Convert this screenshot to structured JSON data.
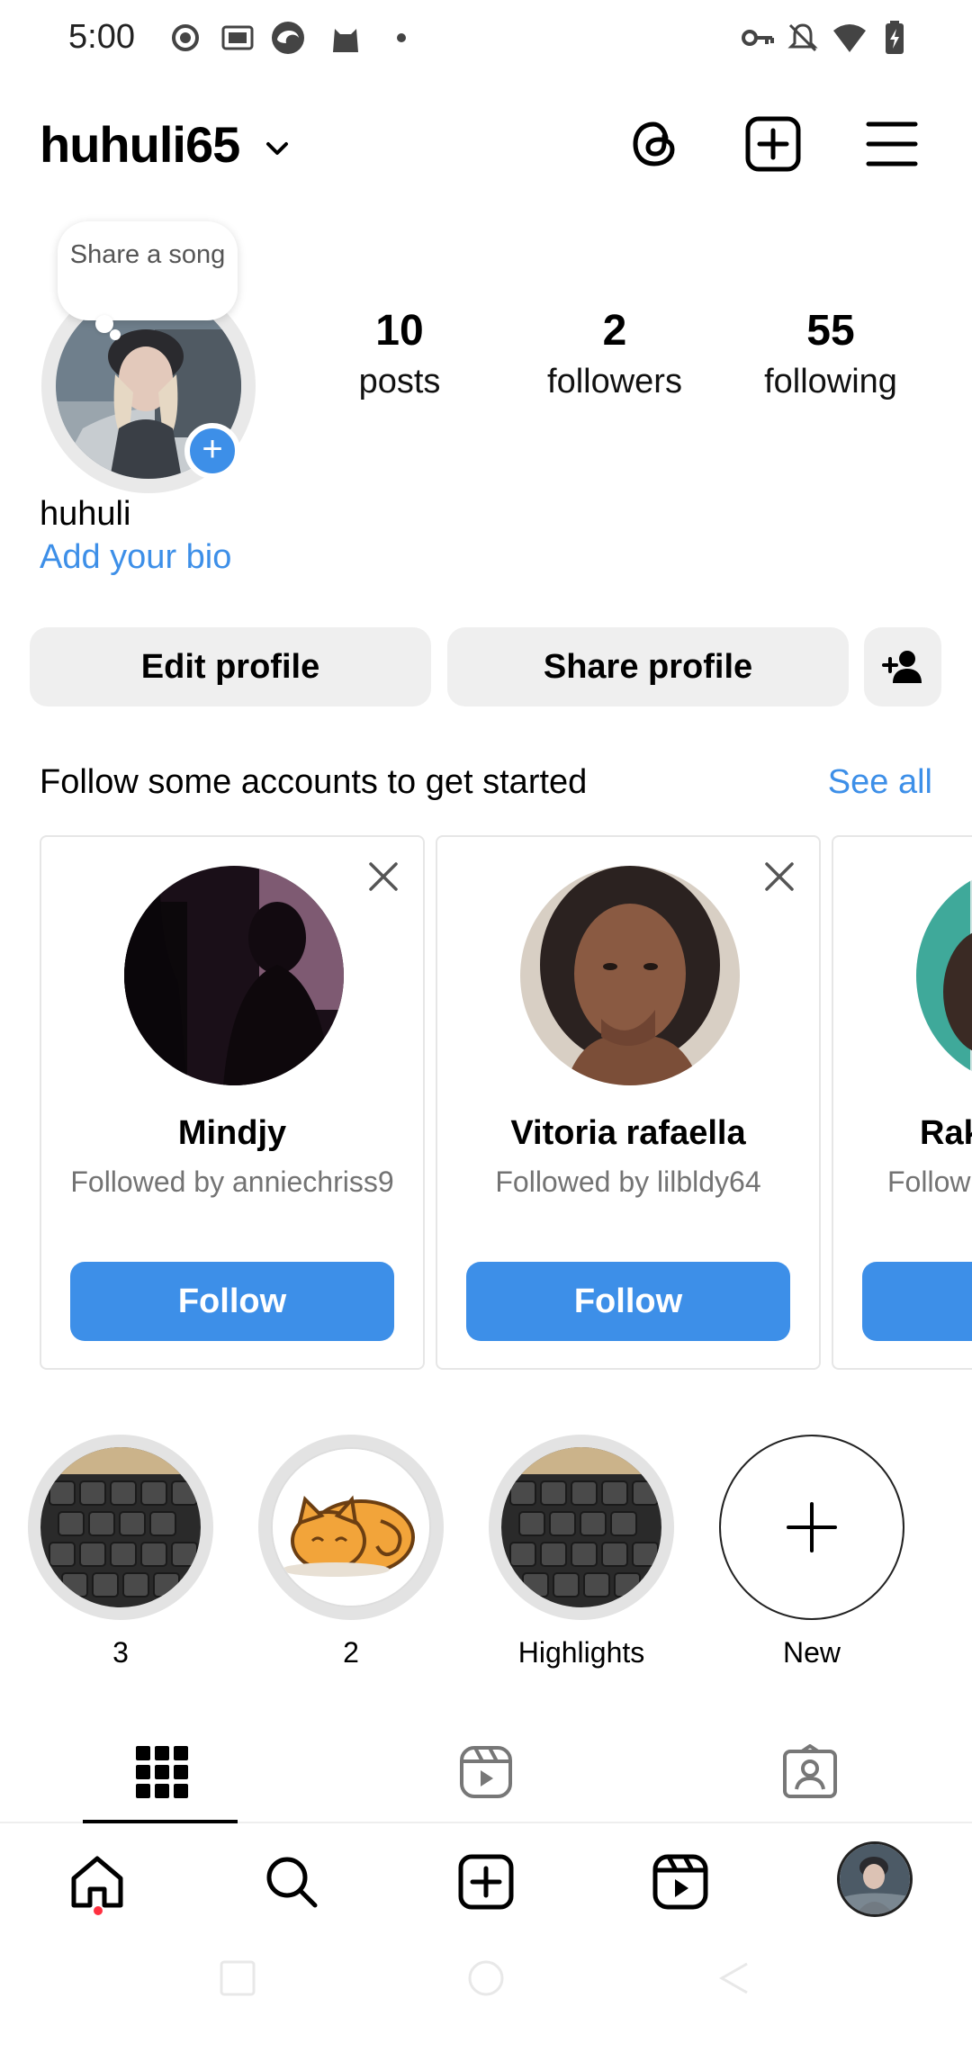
{
  "status_bar": {
    "time": "5:00"
  },
  "header": {
    "username": "huhuli65"
  },
  "profile": {
    "note_text": "Share a song",
    "display_name": "huhuli",
    "bio_link": "Add your bio",
    "stats": [
      {
        "value": "10",
        "label": "posts"
      },
      {
        "value": "2",
        "label": "followers"
      },
      {
        "value": "55",
        "label": "following"
      }
    ]
  },
  "actions": {
    "edit_profile": "Edit profile",
    "share_profile": "Share profile"
  },
  "suggestions": {
    "title": "Follow some accounts to get started",
    "see_all": "See all",
    "cards": [
      {
        "name": "Mindjy",
        "subtitle": "Followed by anniechriss9",
        "button": "Follow"
      },
      {
        "name": "Vitoria rafaella",
        "subtitle": "Followed by lilbldy64",
        "button": "Follow"
      },
      {
        "name": "Rak",
        "subtitle": "Follow",
        "button": ""
      }
    ]
  },
  "highlights": [
    {
      "label": "3"
    },
    {
      "label": "2"
    },
    {
      "label": "Highlights"
    },
    {
      "label": "New"
    }
  ],
  "colors": {
    "accent": "#3d8fe8",
    "notification_dot": "#ff3040"
  }
}
